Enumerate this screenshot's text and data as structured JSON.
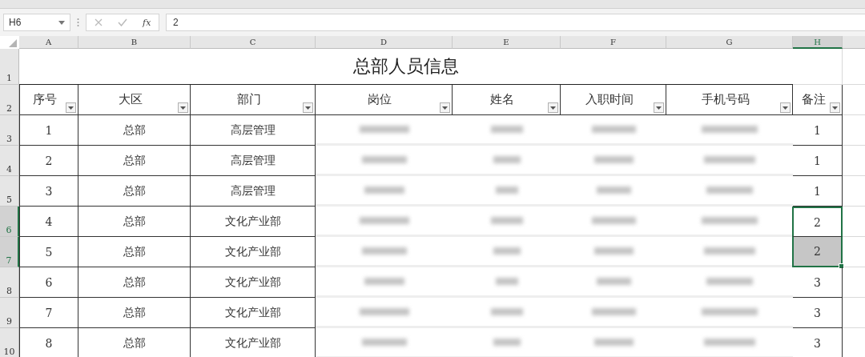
{
  "name_box": "H6",
  "formula_bar": {
    "function_label": "fx",
    "value": "2"
  },
  "columns": [
    {
      "label": "A",
      "selected": false
    },
    {
      "label": "B",
      "selected": false
    },
    {
      "label": "C",
      "selected": false
    },
    {
      "label": "D",
      "selected": false
    },
    {
      "label": "E",
      "selected": false
    },
    {
      "label": "F",
      "selected": false
    },
    {
      "label": "G",
      "selected": false
    },
    {
      "label": "H",
      "selected": true
    }
  ],
  "title_row": {
    "row_number": "1",
    "title": "总部人员信息"
  },
  "header_row": {
    "row_number": "2",
    "headers": [
      "序号",
      "大区",
      "部门",
      "岗位",
      "姓名",
      "入职时间",
      "手机号码",
      "备注"
    ]
  },
  "rows": [
    {
      "row_number": "3",
      "seq": "1",
      "region": "总部",
      "dept": "高层管理",
      "note": "1",
      "selected": false,
      "active": false
    },
    {
      "row_number": "4",
      "seq": "2",
      "region": "总部",
      "dept": "高层管理",
      "note": "1",
      "selected": false,
      "active": false
    },
    {
      "row_number": "5",
      "seq": "3",
      "region": "总部",
      "dept": "高层管理",
      "note": "1",
      "selected": false,
      "active": false
    },
    {
      "row_number": "6",
      "seq": "4",
      "region": "总部",
      "dept": "文化产业部",
      "note": "2",
      "selected": true,
      "active": true
    },
    {
      "row_number": "7",
      "seq": "5",
      "region": "总部",
      "dept": "文化产业部",
      "note": "2",
      "selected": true,
      "active": false
    },
    {
      "row_number": "8",
      "seq": "6",
      "region": "总部",
      "dept": "文化产业部",
      "note": "3",
      "selected": false,
      "active": false
    },
    {
      "row_number": "9",
      "seq": "7",
      "region": "总部",
      "dept": "文化产业部",
      "note": "3",
      "selected": false,
      "active": false
    },
    {
      "row_number": "10",
      "seq": "8",
      "region": "总部",
      "dept": "文化产业部",
      "note": "3",
      "selected": false,
      "active": false
    }
  ]
}
